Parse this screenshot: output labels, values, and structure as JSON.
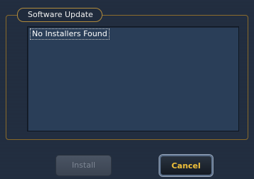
{
  "dialog": {
    "group_title": "Software Update",
    "installers": [
      "No Installers Found"
    ]
  },
  "buttons": {
    "install_label": "Install",
    "cancel_label": "Cancel"
  },
  "colors": {
    "accent_border": "#b08a3c",
    "cancel_text": "#f2c23a",
    "list_background": "#2a3e58"
  }
}
